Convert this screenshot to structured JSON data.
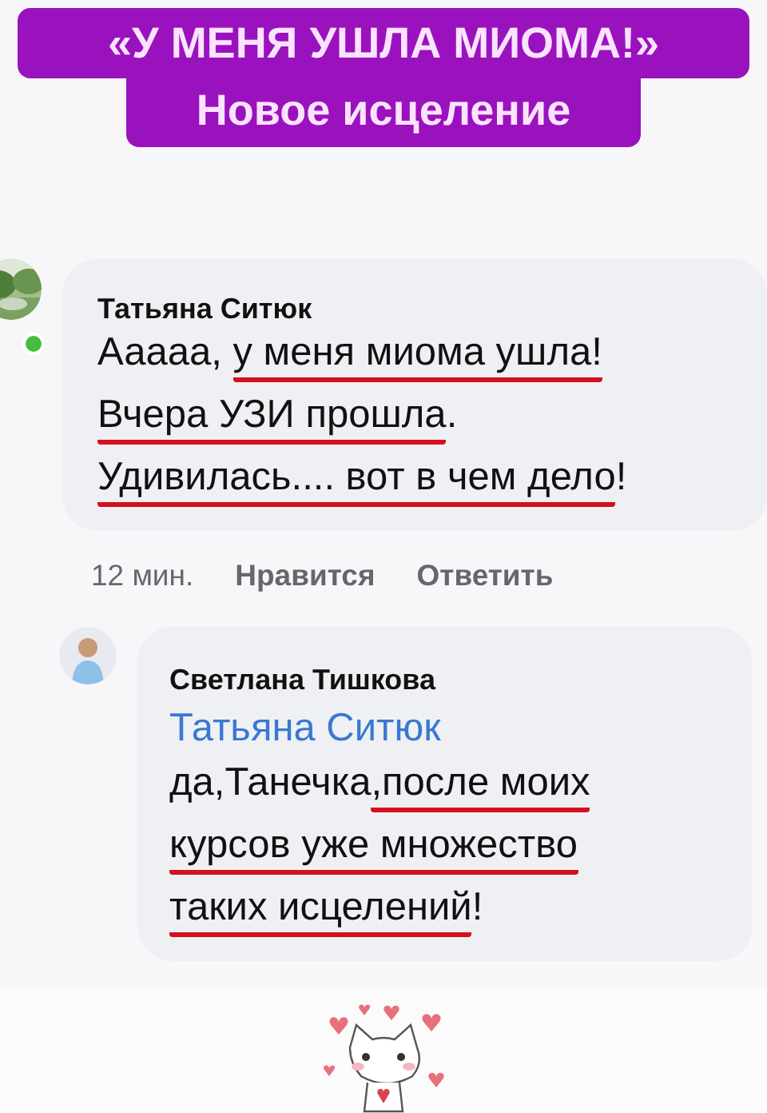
{
  "header": {
    "lines": [
      "«У МЕНЯ УШЛА МИОМА!»",
      "Новое исцеление"
    ]
  },
  "comments": [
    {
      "kind": "comment",
      "avatar": {
        "kind": "picture"
      },
      "online": true,
      "author": "Татьяна Ситюк",
      "lines": [
        [
          {
            "text": "Ааааа, ",
            "underlined": false
          },
          {
            "text": "у меня миома ушла!",
            "underlined": true
          }
        ],
        [
          {
            "text": "Вчера УЗИ прошла",
            "underlined": true
          },
          {
            "text": ".",
            "underlined": false
          }
        ],
        [
          {
            "text": "Удивилась.... вот в чем дело",
            "underlined": true
          },
          {
            "text": "!",
            "underlined": false
          }
        ]
      ],
      "actions": {
        "time": "12 мин.",
        "like": "Нравится",
        "reply": "Ответить"
      }
    },
    {
      "kind": "reply",
      "avatar": {
        "kind": "person"
      },
      "online": false,
      "author": "Светлана Тишкова",
      "mention": "Татьяна Ситюк",
      "lines": [
        [
          {
            "text": "да,Танечка",
            "underlined": false
          },
          {
            "text": ",после моих",
            "underlined": true
          }
        ],
        [
          {
            "text": "курсов уже множество",
            "underlined": true
          }
        ],
        [
          {
            "text": "таких исцелений",
            "underlined": true
          },
          {
            "text": "!",
            "underlined": false
          }
        ]
      ]
    }
  ]
}
